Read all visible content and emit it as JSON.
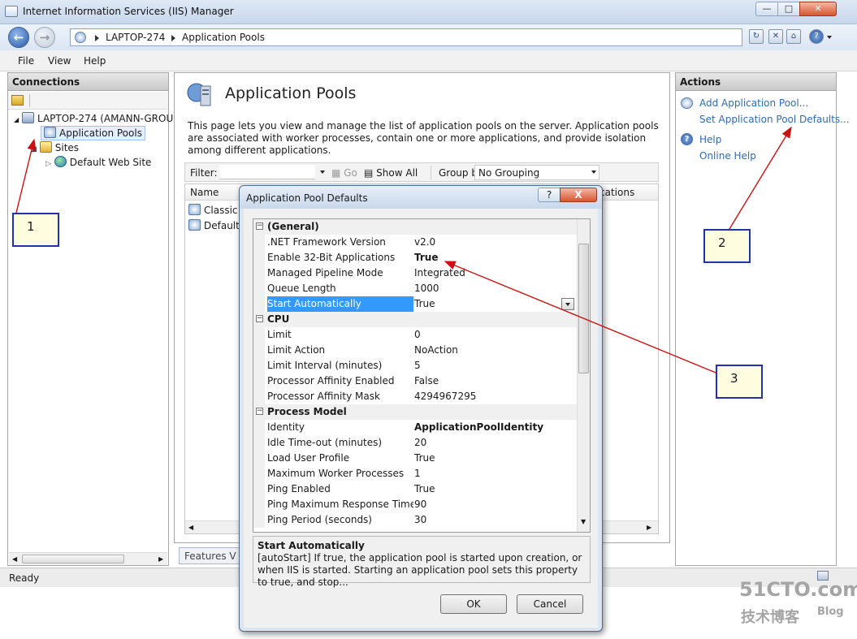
{
  "window": {
    "title": "Internet Information Services (IIS) Manager"
  },
  "address": {
    "crumbs": [
      "LAPTOP-274",
      "Application Pools"
    ]
  },
  "menu": [
    "File",
    "View",
    "Help"
  ],
  "connections": {
    "header": "Connections",
    "tree": [
      {
        "label": "LAPTOP-274 (AMANN-GROU",
        "icon": "server-icon"
      },
      {
        "label": "Application Pools",
        "icon": "app-pool-icon",
        "selected": true
      },
      {
        "label": "Sites",
        "icon": "folder-icon"
      },
      {
        "label": "Default Web Site",
        "icon": "globe-icon"
      }
    ]
  },
  "content": {
    "title": "Application Pools",
    "description": "This page lets you view and manage the list of application pools on the server. Application pools are associated with worker processes, contain one or more applications, and provide isolation among different applications.",
    "filter_label": "Filter:",
    "go_label": "Go",
    "show_all_label": "Show All",
    "group_by_label": "Group by:",
    "group_by_value": "No Grouping",
    "columns": [
      "Name",
      "cations"
    ],
    "rows": [
      "Classic .",
      "DefaultA"
    ],
    "features_tab": "Features V"
  },
  "actions": {
    "header": "Actions",
    "items": [
      "Add Application Pool...",
      "Set Application Pool Defaults...",
      "Help",
      "Online Help"
    ]
  },
  "status": {
    "text": "Ready"
  },
  "dialog": {
    "title": "Application Pool Defaults",
    "help_label": "?",
    "close_label": "X",
    "properties": [
      {
        "type": "cat",
        "name": "(General)"
      },
      {
        "name": ".NET Framework Version",
        "value": "v2.0"
      },
      {
        "name": "Enable 32-Bit Applications",
        "value": "True",
        "bold": true
      },
      {
        "name": "Managed Pipeline Mode",
        "value": "Integrated"
      },
      {
        "name": "Queue Length",
        "value": "1000"
      },
      {
        "name": "Start Automatically",
        "value": "True",
        "selected": true
      },
      {
        "type": "cat",
        "name": "CPU"
      },
      {
        "name": "Limit",
        "value": "0"
      },
      {
        "name": "Limit Action",
        "value": "NoAction"
      },
      {
        "name": "Limit Interval (minutes)",
        "value": "5"
      },
      {
        "name": "Processor Affinity Enabled",
        "value": "False"
      },
      {
        "name": "Processor Affinity Mask",
        "value": "4294967295"
      },
      {
        "type": "cat",
        "name": "Process Model"
      },
      {
        "name": "Identity",
        "value": "ApplicationPoolIdentity",
        "bold": true
      },
      {
        "name": "Idle Time-out (minutes)",
        "value": "20"
      },
      {
        "name": "Load User Profile",
        "value": "True"
      },
      {
        "name": "Maximum Worker Processes",
        "value": "1"
      },
      {
        "name": "Ping Enabled",
        "value": "True"
      },
      {
        "name": "Ping Maximum Response Time (s",
        "value": "90"
      },
      {
        "name": "Ping Period (seconds)",
        "value": "30"
      }
    ],
    "desc_title": "Start Automatically",
    "desc_text": "[autoStart] If true, the application pool is started upon creation, or when IIS is started.  Starting an application pool sets this property to true, and stop...",
    "ok_label": "OK",
    "cancel_label": "Cancel"
  },
  "callouts": [
    "1",
    "2",
    "3"
  ],
  "watermark": {
    "site": "51CTO.com",
    "tagline": "技术博客",
    "blog": "Blog"
  },
  "colors": {
    "accent_link": "#2f6db3",
    "selection": "#3399ff",
    "callout_border": "#2233aa",
    "arrow": "#cc1111"
  }
}
